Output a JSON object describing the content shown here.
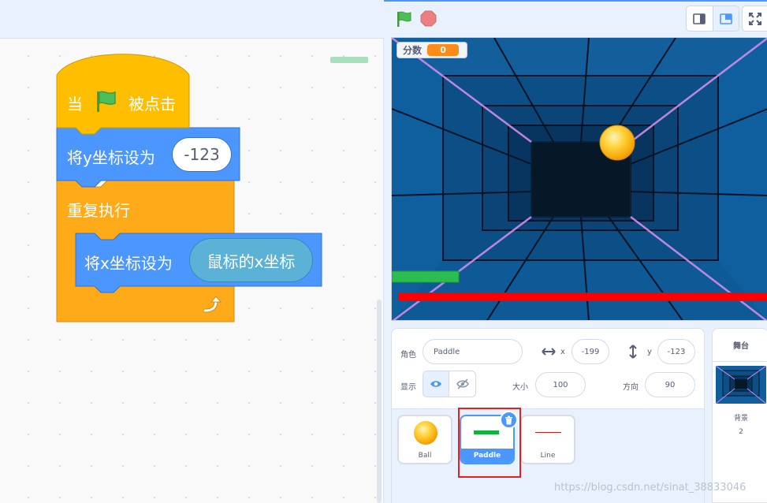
{
  "code": {
    "hat_block": {
      "prefix": "当",
      "flag_icon": "green-flag-icon",
      "suffix": "被点击"
    },
    "set_y_block": {
      "label": "将y坐标设为",
      "value": "-123"
    },
    "forever_block": {
      "label": "重复执行",
      "loop_icon": "loop-arrow-icon"
    },
    "set_x_block": {
      "label": "将x坐标设为",
      "reporter": "鼠标的x坐标"
    }
  },
  "stage_header": {
    "green_flag_icon": "green-flag-icon",
    "stop_icon": "stop-icon",
    "small_stage_icon": "small-stage-icon",
    "large_stage_icon": "large-stage-icon",
    "fullscreen_icon": "fullscreen-icon"
  },
  "stage": {
    "score_monitor": {
      "label": "分数",
      "value": "0"
    }
  },
  "sprite_info": {
    "sprite_label": "角色",
    "sprite_name": "Paddle",
    "x_label": "x",
    "x_value": "-199",
    "y_label": "y",
    "y_value": "-123",
    "show_label": "显示",
    "size_label": "大小",
    "size_value": "100",
    "direction_label": "方向",
    "direction_value": "90"
  },
  "sprites": [
    {
      "name": "Ball"
    },
    {
      "name": "Paddle"
    },
    {
      "name": "Line"
    }
  ],
  "stage_panel": {
    "title": "舞台",
    "backdrops_label": "背景",
    "backdrops_count": "2"
  },
  "watermark": "https://blog.csdn.net/sinat_38833046",
  "colors": {
    "motion_blue": "#4c97ff",
    "events_yellow": "#ffbf00",
    "control_orange": "#ffab19",
    "sensing_cyan": "#5cb1d6",
    "monitor_orange": "#ff8c1a",
    "highlight_red": "#e61f1f"
  }
}
